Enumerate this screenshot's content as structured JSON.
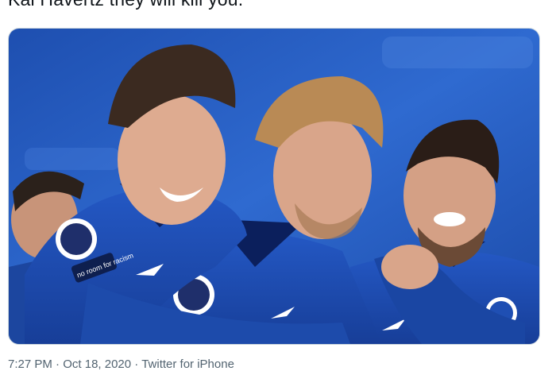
{
  "tweet": {
    "text": "Kai Havertz they will kill you.",
    "time": "7:27 PM",
    "separator": " · ",
    "date": "Oct 18, 2020",
    "source": "Twitter for iPhone"
  },
  "media": {
    "image_alt_visible": "",
    "badge_text": "no room for racism"
  },
  "colors": {
    "stadium_blue": "#2a63c4",
    "kit_blue": "#1f4fb3",
    "kit_dark": "#0b1f5c",
    "skin": "#d9a58a",
    "hair_dark": "#3b2a20",
    "hair_light": "#b98a55"
  }
}
